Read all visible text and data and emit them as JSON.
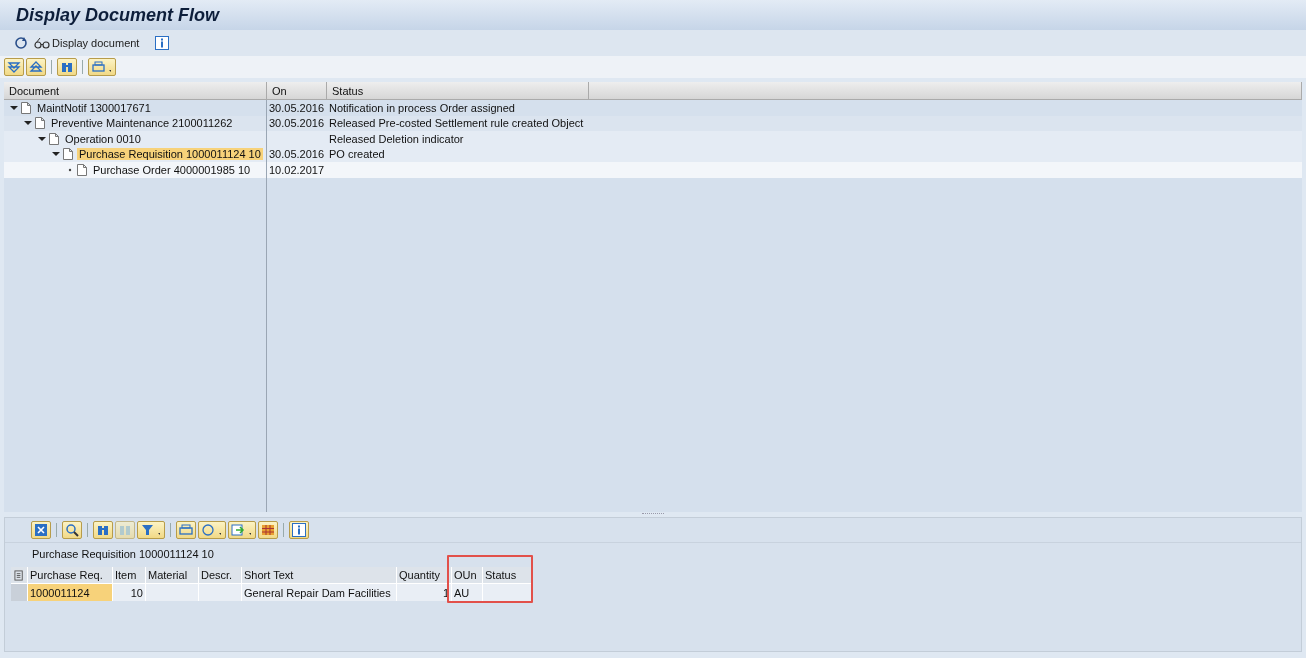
{
  "window": {
    "title": "Display Document Flow"
  },
  "toolbar": {
    "display_button": "Display document"
  },
  "tree": {
    "columns": [
      "Document",
      "On",
      "Status"
    ],
    "nodes": [
      {
        "label": "MaintNotif 1300017671",
        "on": "30.05.2016",
        "status": "Notification in process Order assigned",
        "expanded": true,
        "selected": false,
        "children": [
          {
            "label": "Preventive Maintenance 2100011262",
            "on": "30.05.2016",
            "status": "Released Pre-costed Settlement rule created Object",
            "expanded": true,
            "selected": false,
            "children": [
              {
                "label": "Operation 0010",
                "status": "Released Deletion indicator",
                "expanded": true,
                "selected": false,
                "children": [
                  {
                    "label": "Purchase Requisition 1000011124 10",
                    "on": "30.05.2016",
                    "status": "PO created",
                    "expanded": true,
                    "selected": true,
                    "children": [
                      {
                        "label": "Purchase Order 4000001985 10",
                        "on": "10.02.2017",
                        "selected": false
                      }
                    ]
                  }
                ]
              }
            ]
          }
        ]
      }
    ]
  },
  "detail": {
    "title": "Purchase Requisition 1000011124 10",
    "columns": [
      "Purchase Req.",
      "Item",
      "Material",
      "Descr.",
      "Short Text",
      "Quantity",
      "OUn",
      "Status"
    ],
    "rows": [
      {
        "cells": [
          "1000011124",
          "10",
          "",
          "",
          "General Repair Dam Facilities",
          "1",
          "AU",
          ""
        ],
        "selected": false
      }
    ]
  }
}
